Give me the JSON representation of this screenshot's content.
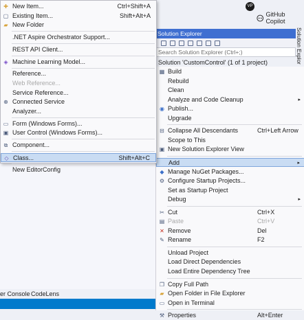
{
  "topbar": {
    "avatar": "VP",
    "copilot_label": "GitHub Copilot"
  },
  "solution_explorer": {
    "title": "Solution Explorer",
    "search_placeholder": "Search Solution Explorer (Ctrl+;)",
    "solution_label": "Solution 'CustomControl' (1 of 1 project)",
    "side_tab": "Solution Explor"
  },
  "bottom_tabs": [
    "er Console",
    "CodeLens"
  ],
  "context_menu": [
    {
      "label": "Build",
      "icon": "build-icon"
    },
    {
      "label": "Rebuild"
    },
    {
      "label": "Clean"
    },
    {
      "label": "Analyze and Code Cleanup",
      "submenu": true
    },
    {
      "label": "Publish...",
      "icon": "publish-icon"
    },
    {
      "label": "Upgrade"
    },
    {
      "separator": true
    },
    {
      "label": "Collapse All Descendants",
      "shortcut": "Ctrl+Left Arrow",
      "icon": "collapse-icon"
    },
    {
      "label": "Scope to This"
    },
    {
      "label": "New Solution Explorer View",
      "icon": "new-view-icon"
    },
    {
      "separator": true
    },
    {
      "label": "Add",
      "submenu": true,
      "highlighted": true
    },
    {
      "label": "Manage NuGet Packages...",
      "icon": "nuget-icon"
    },
    {
      "label": "Configure Startup Projects...",
      "icon": "gear-icon"
    },
    {
      "label": "Set as Startup Project"
    },
    {
      "label": "Debug",
      "submenu": true
    },
    {
      "separator": true
    },
    {
      "label": "Cut",
      "shortcut": "Ctrl+X",
      "icon": "cut-icon"
    },
    {
      "label": "Paste",
      "shortcut": "Ctrl+V",
      "icon": "paste-icon",
      "disabled": true
    },
    {
      "label": "Remove",
      "shortcut": "Del",
      "icon": "remove-icon"
    },
    {
      "label": "Rename",
      "shortcut": "F2",
      "icon": "rename-icon"
    },
    {
      "separator": true
    },
    {
      "label": "Unload Project"
    },
    {
      "label": "Load Direct Dependencies"
    },
    {
      "label": "Load Entire Dependency Tree"
    },
    {
      "separator": true
    },
    {
      "label": "Copy Full Path",
      "icon": "copy-icon"
    },
    {
      "label": "Open Folder in File Explorer",
      "icon": "folder-open-icon"
    },
    {
      "label": "Open in Terminal",
      "icon": "terminal-icon"
    },
    {
      "separator": true
    },
    {
      "label": "Properties",
      "shortcut": "Alt+Enter",
      "icon": "wrench-icon"
    }
  ],
  "add_submenu": [
    {
      "label": "New Item...",
      "shortcut": "Ctrl+Shift+A",
      "icon": "new-item-icon"
    },
    {
      "label": "Existing Item...",
      "shortcut": "Shift+Alt+A",
      "icon": "existing-item-icon"
    },
    {
      "label": "New Folder",
      "icon": "folder-icon"
    },
    {
      "separator": true
    },
    {
      "label": ".NET Aspire Orchestrator Support..."
    },
    {
      "separator": true
    },
    {
      "label": "REST API Client..."
    },
    {
      "separator": true
    },
    {
      "label": "Machine Learning Model...",
      "icon": "ml-icon"
    },
    {
      "separator": true
    },
    {
      "label": "Reference..."
    },
    {
      "label": "Web Reference...",
      "disabled": true
    },
    {
      "label": "Service Reference..."
    },
    {
      "label": "Connected Service",
      "icon": "connected-service-icon"
    },
    {
      "label": "Analyzer..."
    },
    {
      "separator": true
    },
    {
      "label": "Form (Windows Forms)...",
      "icon": "form-icon"
    },
    {
      "label": "User Control (Windows Forms)...",
      "icon": "user-control-icon"
    },
    {
      "separator": true
    },
    {
      "label": "Component...",
      "icon": "component-icon"
    },
    {
      "separator": true
    },
    {
      "label": "Class...",
      "shortcut": "Shift+Alt+C",
      "icon": "class-icon",
      "highlighted": true
    },
    {
      "separator": true
    },
    {
      "label": "New EditorConfig"
    }
  ],
  "colors": {
    "accent": "#3f6fd1",
    "highlight": "#c9dcf3",
    "status_bar": "#007acc"
  }
}
